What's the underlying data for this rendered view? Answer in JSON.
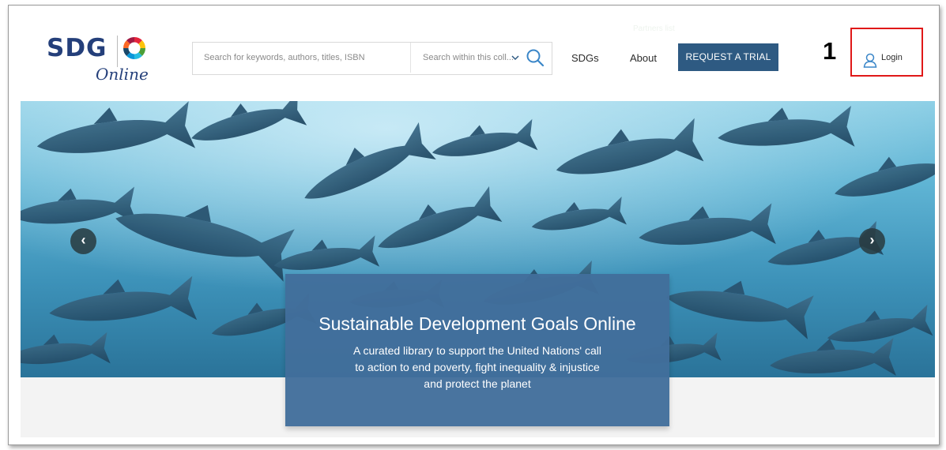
{
  "header": {
    "logo": {
      "main": "SDG",
      "sub": "Online"
    },
    "search": {
      "placeholder": "Search for keywords, authors, titles, ISBN",
      "scope_label": "Search within this coll..."
    },
    "nav": {
      "sdgs": "SDGs",
      "about": "About"
    },
    "trial_button": "REQUEST A TRIAL",
    "faint_text": "Partners list",
    "login": "Login"
  },
  "annotation": {
    "number": "1",
    "color": "#e01818"
  },
  "hero": {
    "title": "Sustainable Development Goals Online",
    "subtitle": "A curated library to support the United Nations' call to action to end poverty, fight inequality & injustice and protect the planet",
    "prev_arrow": "‹",
    "next_arrow": "›"
  },
  "colors": {
    "brand": "#243f7a",
    "trial_button": "#2e5a82",
    "caption_bg": "#426e9b"
  },
  "icons": [
    "sdg-wheel-icon",
    "chevron-down-icon",
    "search-icon",
    "user-icon",
    "chevron-left-icon",
    "chevron-right-icon"
  ]
}
